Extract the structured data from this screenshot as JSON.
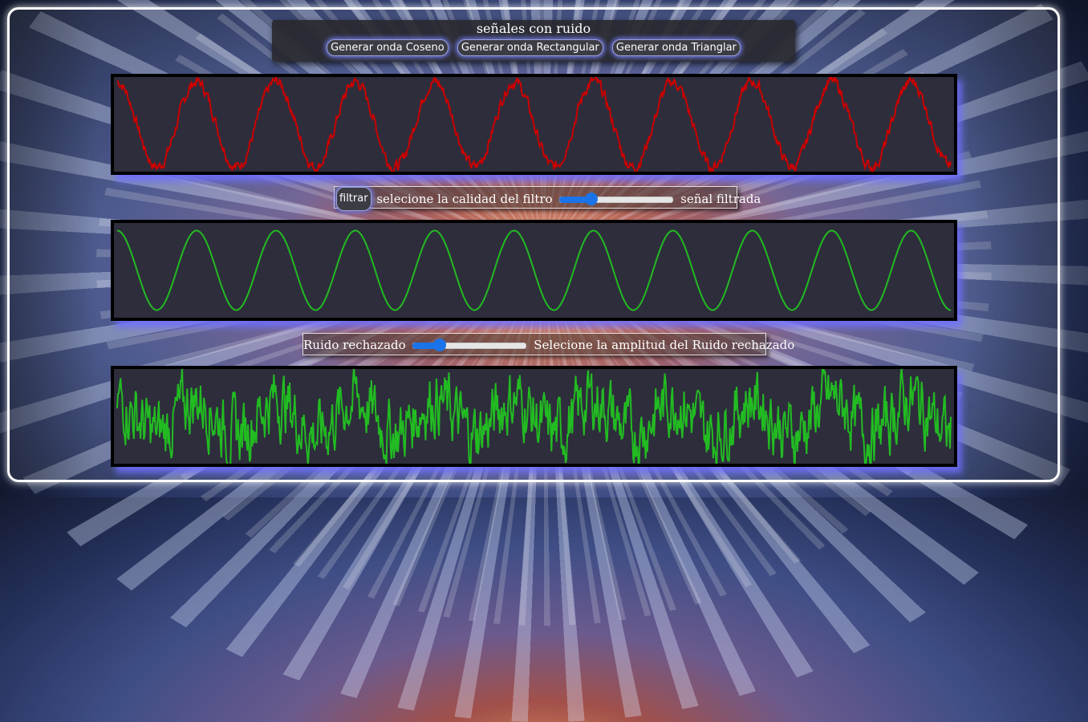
{
  "header": {
    "title": "señales con ruido",
    "buttons": {
      "cosine": "Generar onda Coseno",
      "rectangular": "Generar onda Rectangular",
      "triangular": "Generar onda Trianglar"
    }
  },
  "filter_row": {
    "button": "filtrar",
    "label_before": "selecione la calidad del filtro",
    "label_after": "señal filtrada",
    "slider_value": 0.25
  },
  "noise_row": {
    "label_before": "Ruido rechazado",
    "label_after": "Selecione la amplitud del Ruido rechazado",
    "slider_value": 0.2
  },
  "signals": {
    "noisy": {
      "color": "#cc0000",
      "cycles": 10.5,
      "amplitude": 0.45,
      "noise": 0.05
    },
    "filtered": {
      "color": "#22bb22",
      "cycles": 10.5,
      "amplitude": 0.42,
      "noise": 0.0
    },
    "rejected_noise": {
      "color": "#22bb22",
      "cycles": 10.5,
      "amplitude": 0.18,
      "noise": 0.28
    }
  },
  "colors": {
    "canvas_bg": "#2e2d3c",
    "slider_accent": "#1a73e8",
    "button_glow": "#7882ff"
  }
}
